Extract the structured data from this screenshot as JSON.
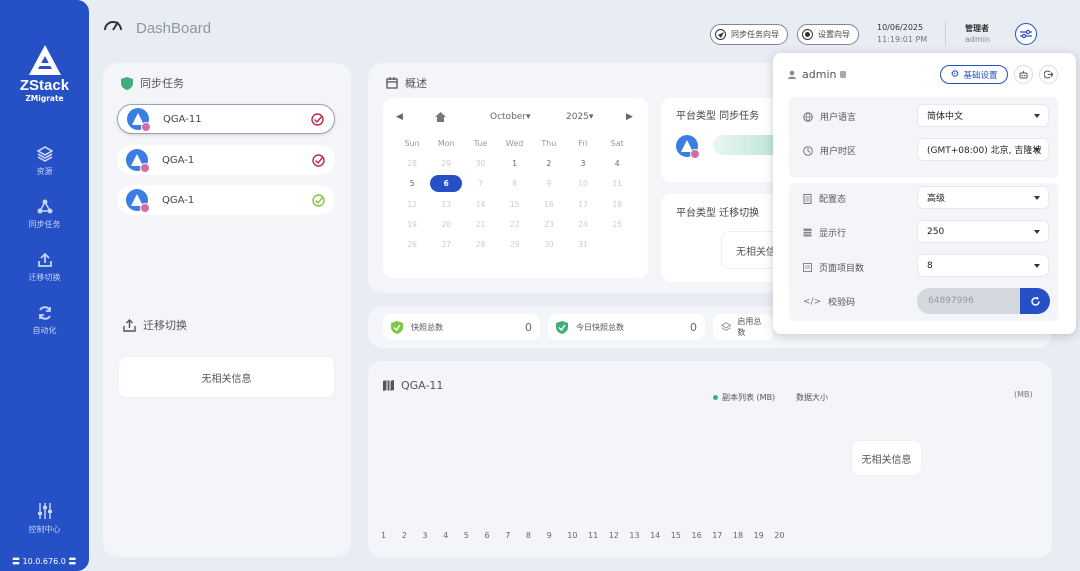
{
  "app": {
    "title": "DashBoard",
    "logo_text": "ZStack",
    "logo_sub": "ZMigrate",
    "version": "10.0.676.0"
  },
  "nav": [
    {
      "label": "资源",
      "icon": "layers-icon"
    },
    {
      "label": "同步任务",
      "icon": "share-icon"
    },
    {
      "label": "迁移切换",
      "icon": "upload-icon"
    },
    {
      "label": "自动化",
      "icon": "refresh-icon"
    }
  ],
  "nav_bottom": {
    "label": "控制中心",
    "icon": "sliders-icon"
  },
  "header": {
    "sync_wizard": "同步任务向导",
    "settings_wizard": "设置向导",
    "date": "10/06/2025",
    "time": "11:19:01 PM",
    "role": "管理者",
    "user": "admin"
  },
  "sync_tasks": {
    "title": "同步任务",
    "items": [
      {
        "name": "QGA-11",
        "status": "error"
      },
      {
        "name": "QGA-1",
        "status": "error"
      },
      {
        "name": "QGA-1",
        "status": "ok"
      }
    ]
  },
  "migration": {
    "title": "迁移切换",
    "empty": "无相关信息"
  },
  "overview": {
    "title": "概述",
    "calendar": {
      "month": "October",
      "year": "2025",
      "weekdays": [
        "Sun",
        "Mon",
        "Tue",
        "Wed",
        "Thu",
        "Fri",
        "Sat"
      ],
      "weeks": [
        [
          "28",
          "29",
          "30",
          "1",
          "2",
          "3",
          "4"
        ],
        [
          "5",
          "6",
          "7",
          "8",
          "9",
          "10",
          "11"
        ],
        [
          "12",
          "13",
          "14",
          "15",
          "16",
          "17",
          "18"
        ],
        [
          "19",
          "20",
          "21",
          "22",
          "23",
          "24",
          "25"
        ],
        [
          "26",
          "27",
          "28",
          "29",
          "30",
          "31",
          ""
        ]
      ],
      "today": "6"
    },
    "platform_sync": "平台类型 同步任务",
    "platform_migrate": "平台类型 迁移切换",
    "platform_empty": "无相关信"
  },
  "stats": [
    {
      "label": "快照总数",
      "value": "0"
    },
    {
      "label": "今日快照总数",
      "value": "0"
    },
    {
      "label": "启用总数",
      "value": ""
    }
  ],
  "chart": {
    "title": "QGA-11",
    "legend": "副本列表 (MB)",
    "legend2": "数据大小",
    "unit": "(MB)",
    "empty": "无相关信息",
    "x_ticks": [
      "1",
      "2",
      "3",
      "4",
      "5",
      "6",
      "7",
      "8",
      "9",
      "10",
      "11",
      "12",
      "13",
      "14",
      "15",
      "16",
      "17",
      "18",
      "19",
      "20"
    ]
  },
  "popup": {
    "user": "admin",
    "basic_settings": "基础设置",
    "rows": [
      {
        "label": "用户语言",
        "value": "简体中文",
        "icon": "globe-icon"
      },
      {
        "label": "用户时区",
        "value": "(GMT+08:00) 北京, 吉隆坡",
        "icon": "clock-icon"
      },
      {
        "label": "配置态",
        "value": "高级",
        "icon": "config-icon"
      },
      {
        "label": "显示行",
        "value": "250",
        "icon": "rows-icon"
      },
      {
        "label": "页面项目数",
        "value": "8",
        "icon": "page-icon"
      },
      {
        "label": "校验码",
        "value": "64897996",
        "icon": "code-icon"
      }
    ]
  },
  "colors": {
    "primary": "#2550c6",
    "ok": "#7ac943",
    "error": "#c0284b",
    "pink": "#d56aa6"
  }
}
